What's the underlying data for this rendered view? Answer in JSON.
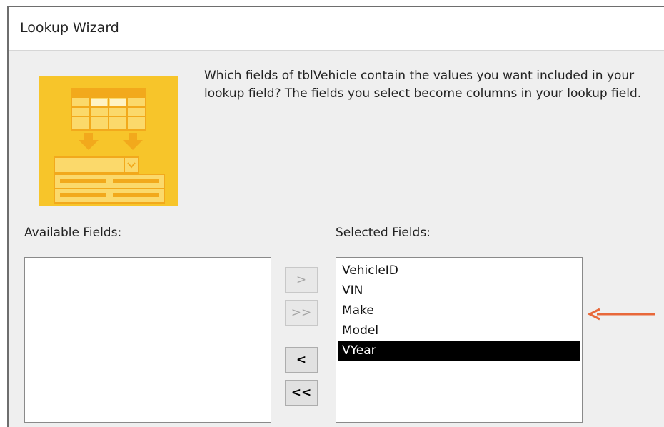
{
  "window": {
    "title": "Lookup Wizard"
  },
  "instruction": "Which fields of tblVehicle contain the values you want included in your lookup field? The fields you select become columns in your lookup field.",
  "available": {
    "label": "Available Fields:",
    "items": []
  },
  "selected": {
    "label": "Selected Fields:",
    "items": [
      "VehicleID",
      "VIN",
      "Make",
      "Model",
      "VYear"
    ],
    "selected_item": "VYear"
  },
  "buttons": {
    "add_one": {
      "label": ">",
      "enabled": false
    },
    "add_all": {
      "label": ">>",
      "enabled": false
    },
    "remove_one": {
      "label": "<",
      "enabled": true
    },
    "remove_all": {
      "label": "<<",
      "enabled": true
    }
  },
  "icons": {
    "wizard_image": "table-lookup-illustration-icon",
    "annotation": "arrow-left-icon"
  },
  "colors": {
    "wizard_image_bg": "#f7c52a",
    "annotation_arrow": "#e8683a",
    "selection_bg": "#000000"
  }
}
